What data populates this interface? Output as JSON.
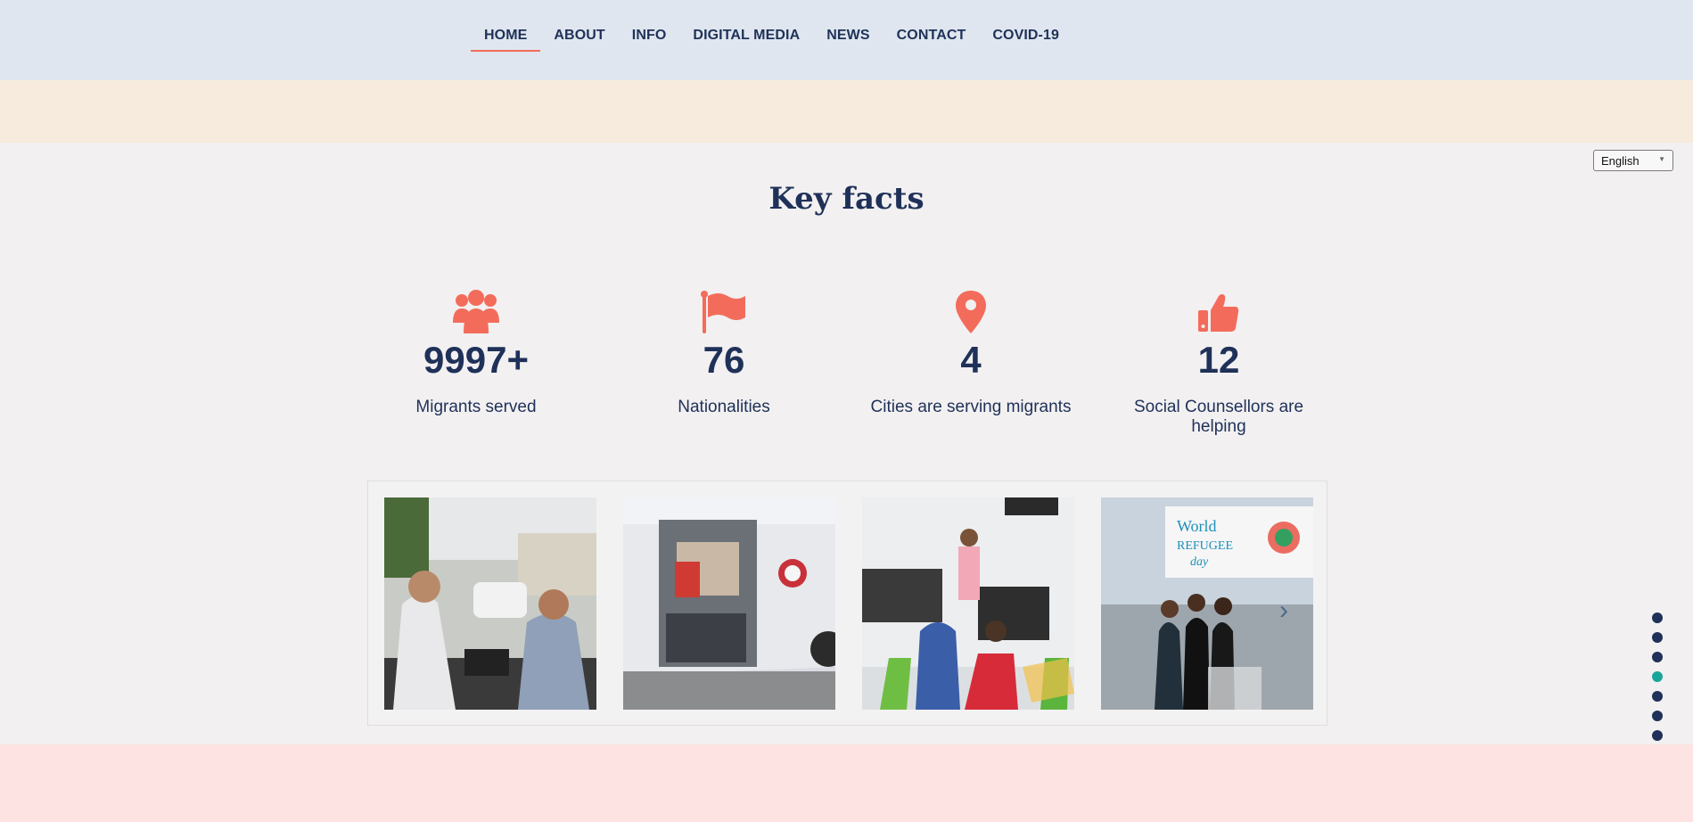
{
  "nav": {
    "items": [
      {
        "label": "HOME",
        "active": true
      },
      {
        "label": "ABOUT"
      },
      {
        "label": "INFO"
      },
      {
        "label": "DIGITAL MEDIA"
      },
      {
        "label": "NEWS"
      },
      {
        "label": "CONTACT"
      },
      {
        "label": "COVID-19"
      }
    ]
  },
  "language": {
    "selected": "English"
  },
  "section": {
    "title": "Key facts"
  },
  "facts": [
    {
      "icon": "users-icon",
      "number": "9997+",
      "label": "Migrants served"
    },
    {
      "icon": "flag-icon",
      "number": "76",
      "label": "Nationalities"
    },
    {
      "icon": "map-pin-icon",
      "number": "4",
      "label": "Cities are serving migrants"
    },
    {
      "icon": "thumbs-up-icon",
      "number": "12",
      "label": "Social Counsellors are helping"
    }
  ],
  "gallery": {
    "photos": [
      {
        "name": "street-outreach-photo"
      },
      {
        "name": "mobile-van-photo"
      },
      {
        "name": "children-activity-photo"
      },
      {
        "name": "world-refugee-day-photo",
        "banner_text": "World REFUGEE day"
      }
    ],
    "next_icon": "chevron-right-icon"
  },
  "pagination": {
    "dots": 7,
    "active_index": 3
  },
  "colors": {
    "accent": "#f36c5b",
    "navy": "#1f3158",
    "teal": "#1aa59a",
    "header_bg": "#dfe6ef",
    "band_bg": "#f6ebdc",
    "footer_bg": "#fde3e1"
  }
}
